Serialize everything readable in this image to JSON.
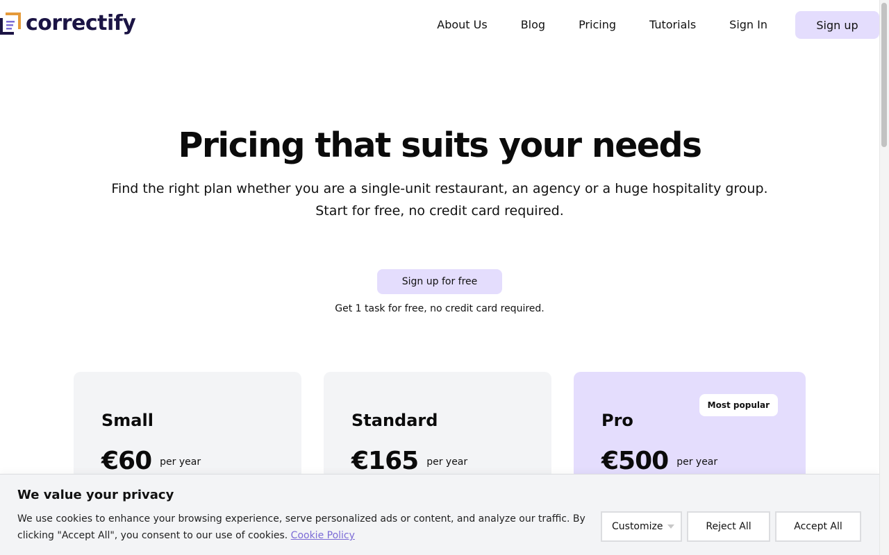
{
  "header": {
    "logo_text": "correctify",
    "nav": [
      "About Us",
      "Blog",
      "Pricing",
      "Tutorials",
      "Sign In"
    ],
    "signup_label": "Sign up"
  },
  "hero": {
    "title": "Pricing that suits your needs",
    "subtitle_line1": "Find the right plan whether you are a single-unit restaurant, an agency or a huge hospitality group.",
    "subtitle_line2": "Start for free, no credit card required.",
    "cta_label": "Sign up for free",
    "note": "Get 1 task for free, no credit card required."
  },
  "plans": [
    {
      "name": "Small",
      "price": "€60",
      "period": "per year"
    },
    {
      "name": "Standard",
      "price": "€165",
      "period": "per year"
    },
    {
      "name": "Pro",
      "price": "€500",
      "period": "per year",
      "badge": "Most popular"
    }
  ],
  "cookie": {
    "title": "We value your privacy",
    "text": "We use cookies to enhance your browsing experience, serve personalized ads or content, and analyze our traffic. By clicking \"Accept All\", you consent to our use of cookies.",
    "link": "Cookie Policy",
    "customize": "Customize",
    "reject": "Reject All",
    "accept": "Accept All"
  },
  "colors": {
    "brand_dark": "#1b1444",
    "accent_lavender": "#e4ddfd",
    "logo_orange": "#e59a3a",
    "logo_purple": "#7b6bd6",
    "card_gray": "#f3f4f6"
  },
  "icons": [
    "correctify-logo-icon",
    "chevron-down-icon"
  ]
}
